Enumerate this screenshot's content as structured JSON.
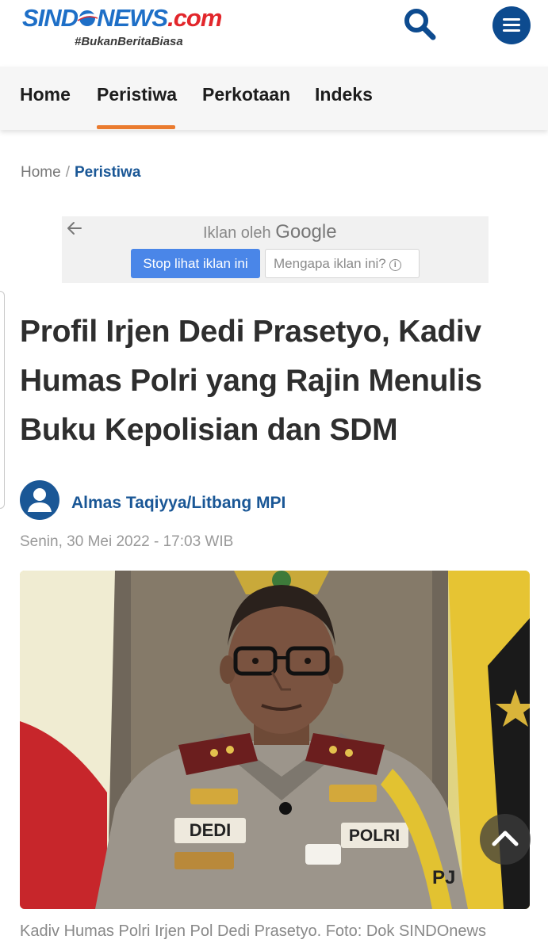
{
  "header": {
    "logo_part1": "SIND",
    "logo_part2": "NEWS",
    "logo_part3": ".com",
    "tagline": "#BukanBeritaBiasa"
  },
  "nav": {
    "items": [
      "Home",
      "Peristiwa",
      "Perkotaan",
      "Indeks"
    ],
    "active": "Peristiwa",
    "accent_color": "#ea7b2f"
  },
  "breadcrumb": {
    "home": "Home",
    "separator": "/",
    "current": "Peristiwa"
  },
  "ad": {
    "label": "Iklan oleh",
    "brand": "Google",
    "stop_button": "Stop lihat iklan ini",
    "why_button": "Mengapa iklan ini?"
  },
  "article": {
    "title": "Profil Irjen Dedi Prasetyo, Kadiv Humas Polri yang Rajin Menulis Buku Kepolisian dan SDM",
    "author": "Almas Taqiyya/Litbang MPI",
    "date": "Senin, 30 Mei 2022 - 17:03 WIB",
    "caption": "Kadiv Humas Polri Irjen Pol Dedi Prasetyo. Foto: Dok SINDOnews",
    "photo_texts": {
      "name_tag": "DEDI",
      "org_tag": "POLRI",
      "flag_text": "PJ"
    }
  },
  "colors": {
    "brand_blue": "#1a5796",
    "menu_blue": "#0d4b8f"
  },
  "icons": [
    "search-icon",
    "menu-icon",
    "arrow-left-icon",
    "info-icon",
    "user-icon",
    "chevron-up-icon"
  ]
}
